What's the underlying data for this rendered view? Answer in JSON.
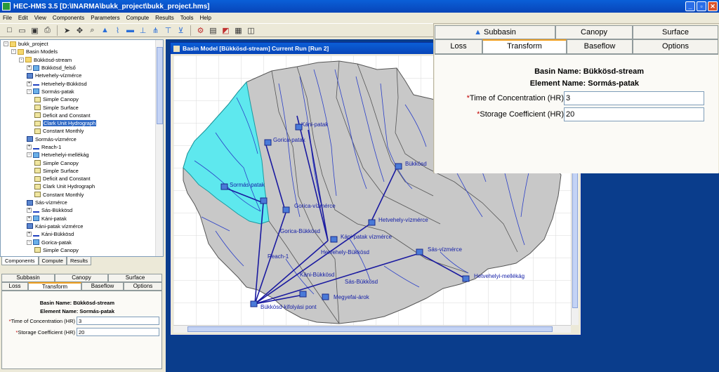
{
  "window": {
    "title": "HEC-HMS 3.5 [D:\\INARMA\\bukk_project\\bukk_project.hms]"
  },
  "menu": [
    "File",
    "Edit",
    "View",
    "Components",
    "Parameters",
    "Compute",
    "Results",
    "Tools",
    "Help"
  ],
  "toolbar_icons": [
    "new-icon",
    "open-icon",
    "save-icon",
    "print-icon",
    "arrow-icon",
    "move-icon",
    "zoom-icon",
    "subbasin-tool-icon",
    "reach-tool-icon",
    "reservoir-tool-icon",
    "junction-tool-icon",
    "diversion-tool-icon",
    "source-tool-icon",
    "sink-tool-icon",
    "compute-icon",
    "global-summary-icon",
    "graph-icon",
    "table-icon",
    "time-series-icon"
  ],
  "tree": [
    {
      "label": "bukk_project",
      "indent": 0,
      "icon": "fold",
      "exp": "-"
    },
    {
      "label": "Basin Models",
      "indent": 1,
      "icon": "fold",
      "exp": "-"
    },
    {
      "label": "Bükkösd-stream",
      "indent": 2,
      "icon": "fold",
      "exp": "-"
    },
    {
      "label": "Bükkösd_felső",
      "indent": 3,
      "icon": "sub",
      "exp": "+"
    },
    {
      "label": "Hetvehely-vízmérce",
      "indent": 3,
      "icon": "jun",
      "exp": ""
    },
    {
      "label": "Hetvehely-Bükkösd",
      "indent": 3,
      "icon": "reach",
      "exp": "+"
    },
    {
      "label": "Sormás-patak",
      "indent": 3,
      "icon": "sub",
      "exp": "-"
    },
    {
      "label": "Simple Canopy",
      "indent": 4,
      "icon": "meth",
      "exp": ""
    },
    {
      "label": "Simple Surface",
      "indent": 4,
      "icon": "meth",
      "exp": ""
    },
    {
      "label": "Deficit and Constant",
      "indent": 4,
      "icon": "meth",
      "exp": ""
    },
    {
      "label": "Clark Unit Hydrograph",
      "indent": 4,
      "icon": "meth",
      "exp": "",
      "sel": true
    },
    {
      "label": "Constant Monthly",
      "indent": 4,
      "icon": "meth",
      "exp": ""
    },
    {
      "label": "Sormás-vízmérce",
      "indent": 3,
      "icon": "jun",
      "exp": ""
    },
    {
      "label": "Reach-1",
      "indent": 3,
      "icon": "reach",
      "exp": "+"
    },
    {
      "label": "Hetvehelyi-mellékág",
      "indent": 3,
      "icon": "sub",
      "exp": "-"
    },
    {
      "label": "Simple Canopy",
      "indent": 4,
      "icon": "meth",
      "exp": ""
    },
    {
      "label": "Simple Surface",
      "indent": 4,
      "icon": "meth",
      "exp": ""
    },
    {
      "label": "Deficit and Constant",
      "indent": 4,
      "icon": "meth",
      "exp": ""
    },
    {
      "label": "Clark Unit Hydrograph",
      "indent": 4,
      "icon": "meth",
      "exp": ""
    },
    {
      "label": "Constant Monthly",
      "indent": 4,
      "icon": "meth",
      "exp": ""
    },
    {
      "label": "Sás-vízmérce",
      "indent": 3,
      "icon": "jun",
      "exp": ""
    },
    {
      "label": "Sás-Bükkösd",
      "indent": 3,
      "icon": "reach",
      "exp": "+"
    },
    {
      "label": "Káni-patak",
      "indent": 3,
      "icon": "sub",
      "exp": "+"
    },
    {
      "label": "Káni-patak vízmérce",
      "indent": 3,
      "icon": "jun",
      "exp": ""
    },
    {
      "label": "Káni-Bükkösd",
      "indent": 3,
      "icon": "reach",
      "exp": "+"
    },
    {
      "label": "Gorica-patak",
      "indent": 3,
      "icon": "sub",
      "exp": "-"
    },
    {
      "label": "Simple Canopy",
      "indent": 4,
      "icon": "meth",
      "exp": ""
    }
  ],
  "bottom_tabs": [
    "Components",
    "Compute",
    "Results"
  ],
  "editor": {
    "tabs_top": [
      "Subbasin",
      "Canopy",
      "Surface"
    ],
    "tabs_bottom": [
      "Loss",
      "Transform",
      "Baseflow",
      "Options"
    ],
    "active_tab": "Transform",
    "basin_label": "Basin Name:",
    "basin_name": "Bükkösd-stream",
    "element_label": "Element Name:",
    "element_name": "Sormás-patak",
    "toc_label": "Time of Concentration (HR)",
    "toc_value": "3",
    "storage_label": "Storage Coefficient (HR)",
    "storage_value": "20",
    "required_mark": "*"
  },
  "map_window": {
    "title": "Basin Model [Bükkösd-stream]  Current Run [Run 2]",
    "labels": [
      {
        "id": "kani-patak",
        "text": "Káni-patak"
      },
      {
        "id": "gorica-patak",
        "text": "Gorica-patak"
      },
      {
        "id": "bukkosd",
        "text": "Bükkösd"
      },
      {
        "id": "sormas-patak",
        "text": "Sormás-patak"
      },
      {
        "id": "gorica-vizmerce",
        "text": "Gorica-vízmérce"
      },
      {
        "id": "hetvehely-vizmerce",
        "text": "Hetvehely-vízmérce"
      },
      {
        "id": "gorica-bukkosd",
        "text": "Gorica-Bükkösd"
      },
      {
        "id": "kani-patak-vizmerce",
        "text": "Káni-patak vízmérce"
      },
      {
        "id": "sas-vizmerce",
        "text": "Sás-vízmérce"
      },
      {
        "id": "hetvehely-bukkosd",
        "text": "Hetvehely-Bükkösd"
      },
      {
        "id": "reach-1",
        "text": "Reach-1"
      },
      {
        "id": "hetvehelyi-mellekag",
        "text": "Hetvehelyi-mellékág"
      },
      {
        "id": "kani-bukkosd",
        "text": "Káni-Bükkösd"
      },
      {
        "id": "sas-bukkosd",
        "text": "Sás-Bükkösd"
      },
      {
        "id": "megyefai-arok",
        "text": "Megyefai-árok"
      },
      {
        "id": "bukkosd-kifolyasi-pont",
        "text": "Bükkösd-kifolyási pont"
      }
    ]
  },
  "colors": {
    "titlebar": "#0845b8",
    "basin_fill": "#c8c8c8",
    "selected_subbasin": "#5ee8ee",
    "stream": "#2a3fc8",
    "reach": "#1a1aa0",
    "background": "#0a3d8c"
  }
}
